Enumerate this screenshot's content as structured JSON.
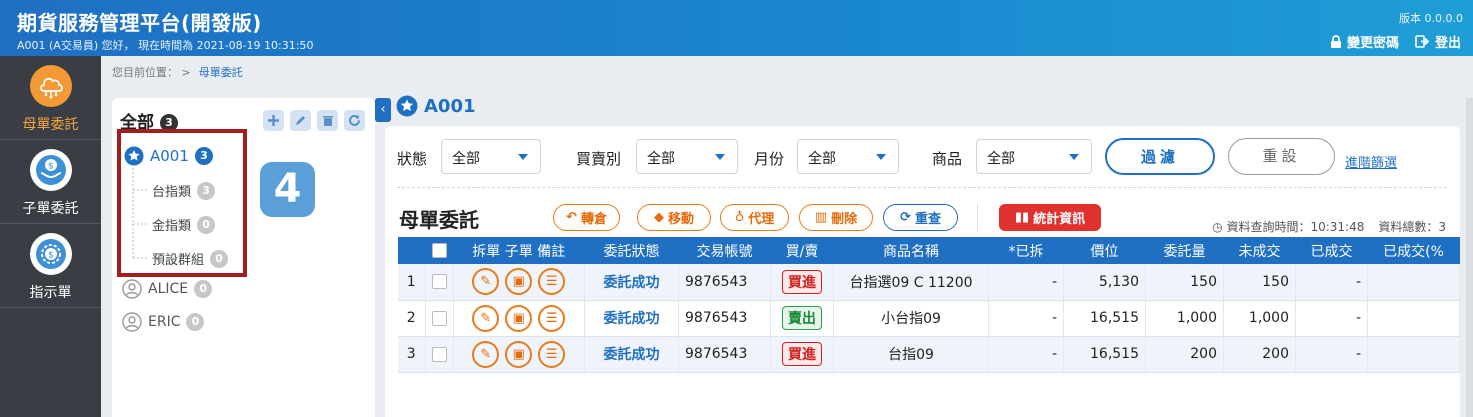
{
  "header": {
    "title": "期貨服務管理平台(開發版)",
    "user_line": "A001 (A交易員)   您好，   現在時間為   2021-08-19 10:31:50",
    "version": "版本 0.0.0.0",
    "change_password": "變更密碼",
    "logout": "登出"
  },
  "nav": {
    "items": [
      {
        "label": "母單委託",
        "icon": "cloud-network-icon"
      },
      {
        "label": "子單委託",
        "icon": "money-hands-icon"
      },
      {
        "label": "指示單",
        "icon": "dollar-gear-icon"
      }
    ]
  },
  "breadcrumb": {
    "prefix": "您目前位置：  >",
    "current": "母單委託"
  },
  "tree": {
    "header_label": "全部",
    "header_count": "3",
    "nodes": [
      {
        "label": "A001",
        "count": "3"
      },
      {
        "label": "台指類",
        "count": "3"
      },
      {
        "label": "金指類",
        "count": "0"
      },
      {
        "label": "預設群組",
        "count": "0"
      },
      {
        "label": "ALICE",
        "count": "0"
      },
      {
        "label": "ERIC",
        "count": "0"
      }
    ],
    "step_number": "4"
  },
  "account": {
    "title": "A001"
  },
  "filters": {
    "status_label": "狀態",
    "status_value": "全部",
    "side_label": "買賣別",
    "side_value": "全部",
    "month_label": "月份",
    "month_value": "全部",
    "product_label": "商品",
    "product_value": "全部",
    "filter_button": "過濾",
    "reset_button": "重設",
    "advanced_link": "進階篩選"
  },
  "section": {
    "title": "母單委託",
    "actions": {
      "transfer": "轉倉",
      "move": "移動",
      "proxy": "代理",
      "delete": "刪除",
      "reorder": "重查"
    },
    "stats_button": "統計資訊",
    "query_time": "資料查詢時間：10:31:48",
    "total": "資料總數：3"
  },
  "table": {
    "headers": [
      "拆單",
      "子單",
      "備註",
      "委託狀態",
      "交易帳號",
      "買/賣",
      "商品名稱",
      "*已拆",
      "價位",
      "委託量",
      "未成交",
      "已成交",
      "已成交(%"
    ],
    "rows": [
      {
        "no": "1",
        "status": "委託成功",
        "account": "9876543",
        "side": "買進",
        "product": "台指選09 C 11200",
        "split": "-",
        "price": "5,130",
        "qty": "150",
        "open": "150",
        "filled": "-"
      },
      {
        "no": "2",
        "status": "委託成功",
        "account": "9876543",
        "side": "賣出",
        "product": "小台指09",
        "split": "-",
        "price": "16,515",
        "qty": "1,000",
        "open": "1,000",
        "filled": "-"
      },
      {
        "no": "3",
        "status": "委託成功",
        "account": "9876543",
        "side": "買進",
        "product": "台指09",
        "split": "-",
        "price": "16,515",
        "qty": "200",
        "open": "200",
        "filled": "-"
      }
    ]
  },
  "colors": {
    "primary": "#1f6fc2",
    "accent_orange": "#e87b1c",
    "buy_red": "#d2201e",
    "sell_green": "#1e8a3a",
    "stat_red": "#e0312f",
    "highlight_box": "#a31d1d"
  }
}
